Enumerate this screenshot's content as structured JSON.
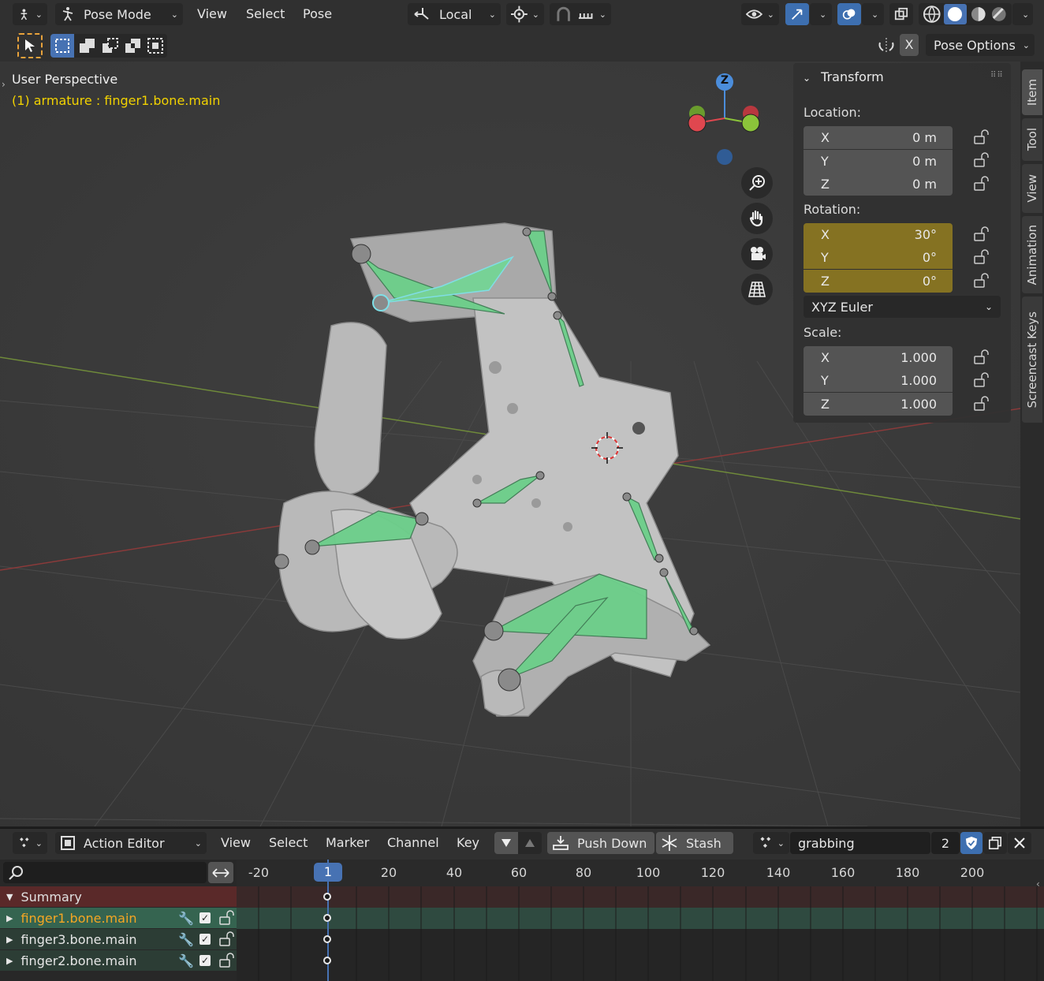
{
  "top_header": {
    "mode": "Pose Mode",
    "menus": [
      "View",
      "Select",
      "Pose"
    ],
    "orientation": "Local"
  },
  "sub_header": {
    "x_label": "X",
    "pose_options": "Pose Options"
  },
  "viewport": {
    "title": "User Perspective",
    "subtitle": "(1) armature : finger1.bone.main",
    "gizmo_z": "Z"
  },
  "transform": {
    "title": "Transform",
    "location_label": "Location:",
    "location": [
      {
        "axis": "X",
        "value": "0 m"
      },
      {
        "axis": "Y",
        "value": "0 m"
      },
      {
        "axis": "Z",
        "value": "0 m"
      }
    ],
    "rotation_label": "Rotation:",
    "rotation": [
      {
        "axis": "X",
        "value": "30°"
      },
      {
        "axis": "Y",
        "value": "0°"
      },
      {
        "axis": "Z",
        "value": "0°"
      }
    ],
    "rotation_mode": "XYZ Euler",
    "scale_label": "Scale:",
    "scale": [
      {
        "axis": "X",
        "value": "1.000"
      },
      {
        "axis": "Y",
        "value": "1.000"
      },
      {
        "axis": "Z",
        "value": "1.000"
      }
    ]
  },
  "side_tabs": [
    "Item",
    "Tool",
    "View",
    "Animation",
    "Screencast Keys"
  ],
  "action_editor": {
    "editor": "Action Editor",
    "menus": [
      "View",
      "Select",
      "Marker",
      "Channel",
      "Key"
    ],
    "push_down": "Push Down",
    "stash": "Stash",
    "action_name": "grabbing",
    "users": "2",
    "current_frame": "1",
    "ruler_labels": [
      "-20",
      "20",
      "40",
      "60",
      "80",
      "100",
      "120",
      "140",
      "160",
      "180",
      "200"
    ],
    "channels": [
      {
        "name": "Summary",
        "kind": "summary"
      },
      {
        "name": "finger1.bone.main",
        "kind": "selected"
      },
      {
        "name": "finger3.bone.main",
        "kind": "normal"
      },
      {
        "name": "finger2.bone.main",
        "kind": "normal"
      }
    ]
  },
  "colors": {
    "accent_blue": "#4772b3",
    "animated_field": "#857222",
    "bone_green": "#6ccf8a",
    "active_text": "#f2d200"
  }
}
